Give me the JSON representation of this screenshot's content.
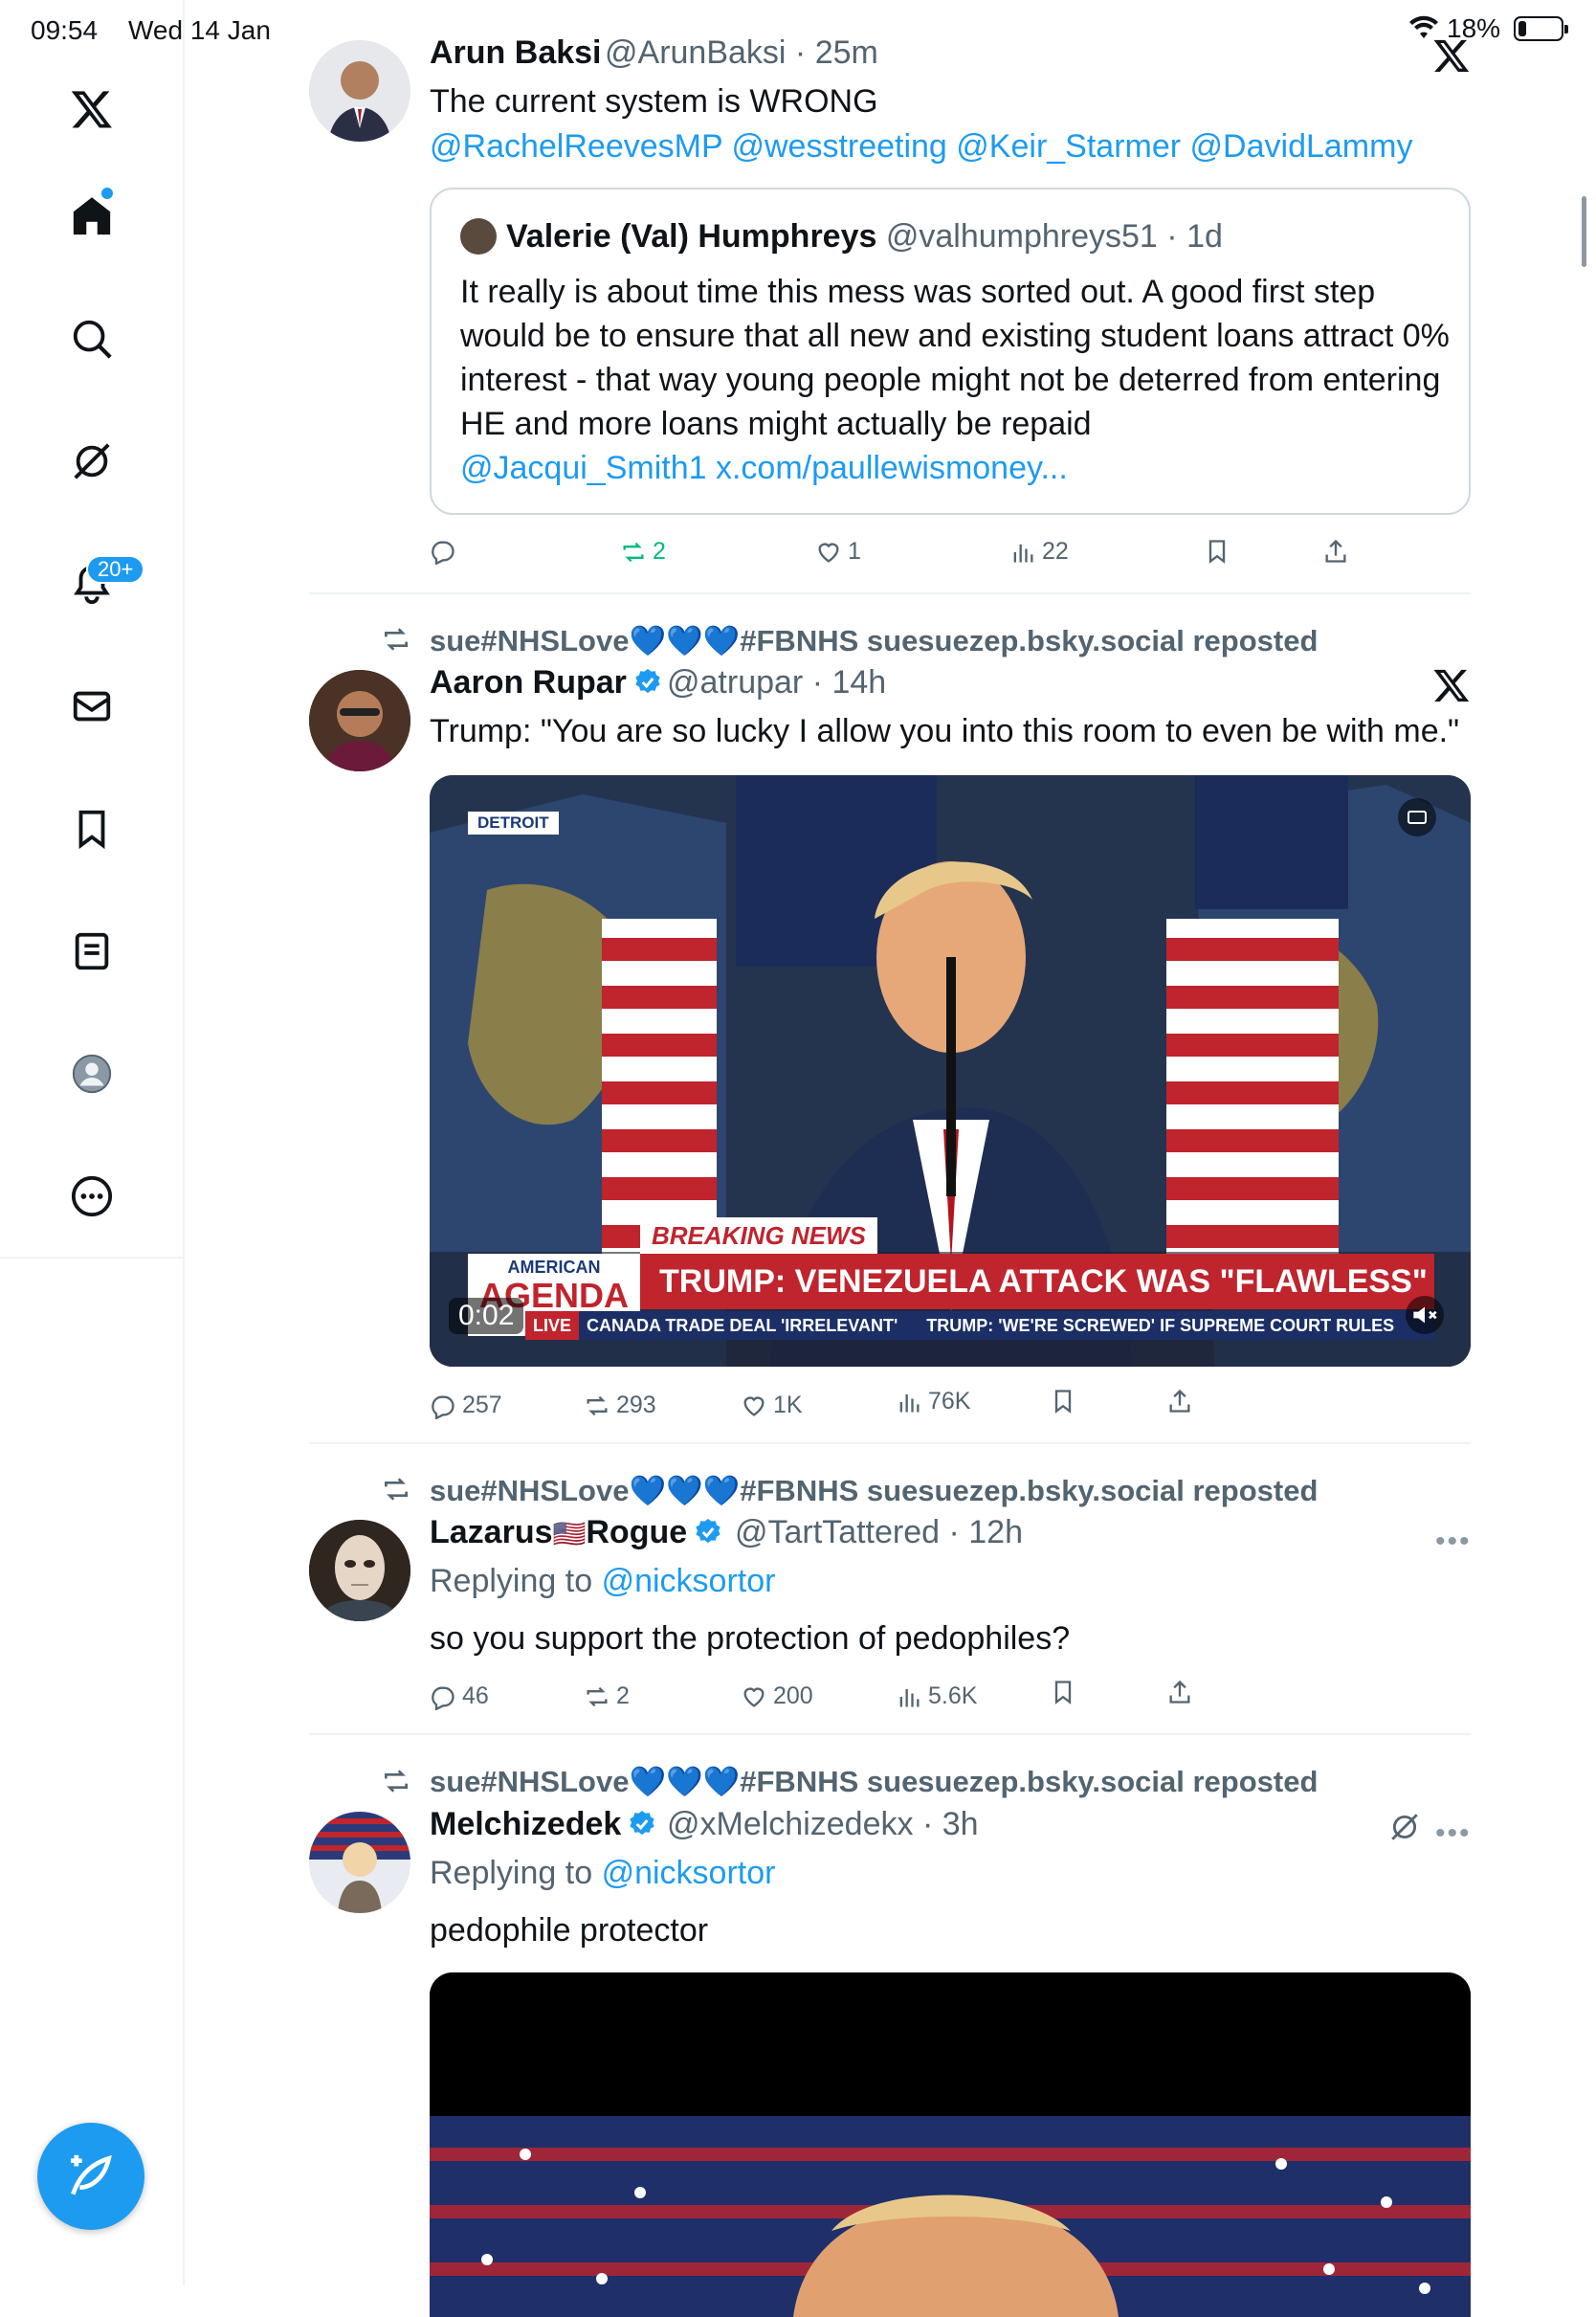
{
  "status_bar": {
    "time": "09:54",
    "date": "Wed 14 Jan",
    "battery": "18%"
  },
  "sidebar": {
    "items": [
      {
        "name": "x-logo"
      },
      {
        "name": "home"
      },
      {
        "name": "search"
      },
      {
        "name": "grok"
      },
      {
        "name": "notifications",
        "badge": "20+"
      },
      {
        "name": "messages"
      },
      {
        "name": "bookmarks"
      },
      {
        "name": "lists"
      },
      {
        "name": "profile"
      },
      {
        "name": "more"
      }
    ],
    "accent": "#1d9bf0"
  },
  "posts": [
    {
      "name": "Arun Baksi",
      "handle": "@ArunBaksi",
      "time": "25m",
      "text": "The current system is WRONG",
      "mentions": "@RachelReevesMP @wesstreeting @Keir_Starmer @DavidLammy",
      "quote": {
        "name": "Valerie (Val) Humphreys",
        "handle": "@valhumphreys51",
        "time": "1d",
        "text": "It really is about time this mess was sorted out. A good first step would be to ensure that all new and existing student loans attract 0% interest - that way young people might not be deterred from entering HE and more loans might actually be repaid",
        "links": "@Jacqui_Smith1 x.com/paullewismoney..."
      },
      "stats": {
        "replies": "",
        "reposts": "2",
        "likes": "1",
        "views": "22"
      }
    },
    {
      "repost_by": "sue#NHSLove💙💙💙#FBNHS suesuezep.bsky.social reposted",
      "name": "Aaron Rupar",
      "handle": "@atrupar",
      "time": "14h",
      "text": "Trump: \"You are so lucky I allow you into this room to even be with me.\"",
      "video": {
        "duration": "0:02",
        "tag": "DETROIT",
        "breaking": "BREAKING NEWS",
        "headline": "TRUMP: VENEZUELA ATTACK WAS \"FLAWLESS\"",
        "show_top": "AMERICAN",
        "show": "AGENDA",
        "live": "LIVE",
        "ticker1": "CANADA TRADE DEAL 'IRRELEVANT'",
        "ticker2": "TRUMP: 'WE'RE SCREWED' IF SUPREME COURT RULES"
      },
      "stats": {
        "replies": "257",
        "reposts": "293",
        "likes": "1K",
        "views": "76K"
      }
    },
    {
      "repost_by": "sue#NHSLove💙💙💙#FBNHS suesuezep.bsky.social reposted",
      "name_a": "Lazarus",
      "flag": "🇺🇸",
      "name_b": "Rogue",
      "handle": "@TartTattered",
      "time": "12h",
      "replying_label": "Replying to",
      "replying_to": "@nicksortor",
      "text": "so you support the protection of pedophiles?",
      "stats": {
        "replies": "46",
        "reposts": "2",
        "likes": "200",
        "views": "5.6K"
      }
    },
    {
      "repost_by": "sue#NHSLove💙💙💙#FBNHS suesuezep.bsky.social reposted",
      "name": "Melchizedek",
      "handle": "@xMelchizedekx",
      "time": "3h",
      "replying_label": "Replying to",
      "replying_to": "@nicksortor",
      "text": "pedophile protector"
    }
  ]
}
